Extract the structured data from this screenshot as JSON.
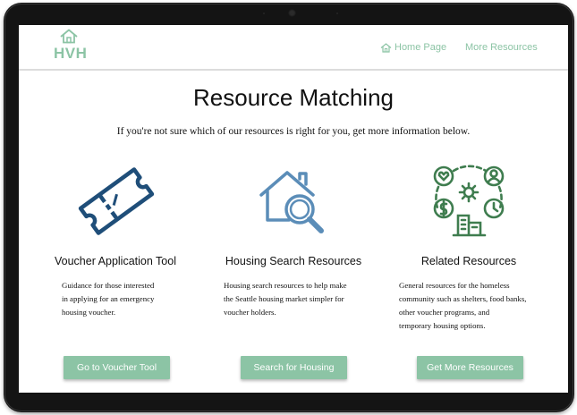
{
  "header": {
    "logo_text": "HVH",
    "nav": [
      {
        "label": "Home Page",
        "icon": "home-icon"
      },
      {
        "label": "More Resources"
      }
    ]
  },
  "main": {
    "title": "Resource Matching",
    "subtitle": "If you're not sure which of our resources is right for you, get more information below.",
    "columns": [
      {
        "title": "Voucher Application Tool",
        "desc_lines": [
          "Guidance for those interested",
          "in applying for an emergency",
          "housing voucher."
        ],
        "button": "Go to Voucher Tool",
        "icon": "ticket-icon"
      },
      {
        "title": "Housing Search Resources",
        "desc_lines": [
          "Housing search resources to help make",
          "the Seattle housing market simpler for",
          "voucher holders."
        ],
        "button": "Search for Housing",
        "icon": "house-search-icon"
      },
      {
        "title": "Related Resources",
        "desc_lines": [
          "General resources for the homeless",
          "community such as shelters, food banks,",
          "other voucher programs, and",
          "temporary housing options."
        ],
        "button": "Get More Resources",
        "icon": "community-resources-icon"
      }
    ]
  },
  "colors": {
    "accent": "#8cc4a5",
    "ticket_blue": "#1f4e79",
    "house_blue": "#5b8db8",
    "resource_green": "#3f7d4f"
  }
}
